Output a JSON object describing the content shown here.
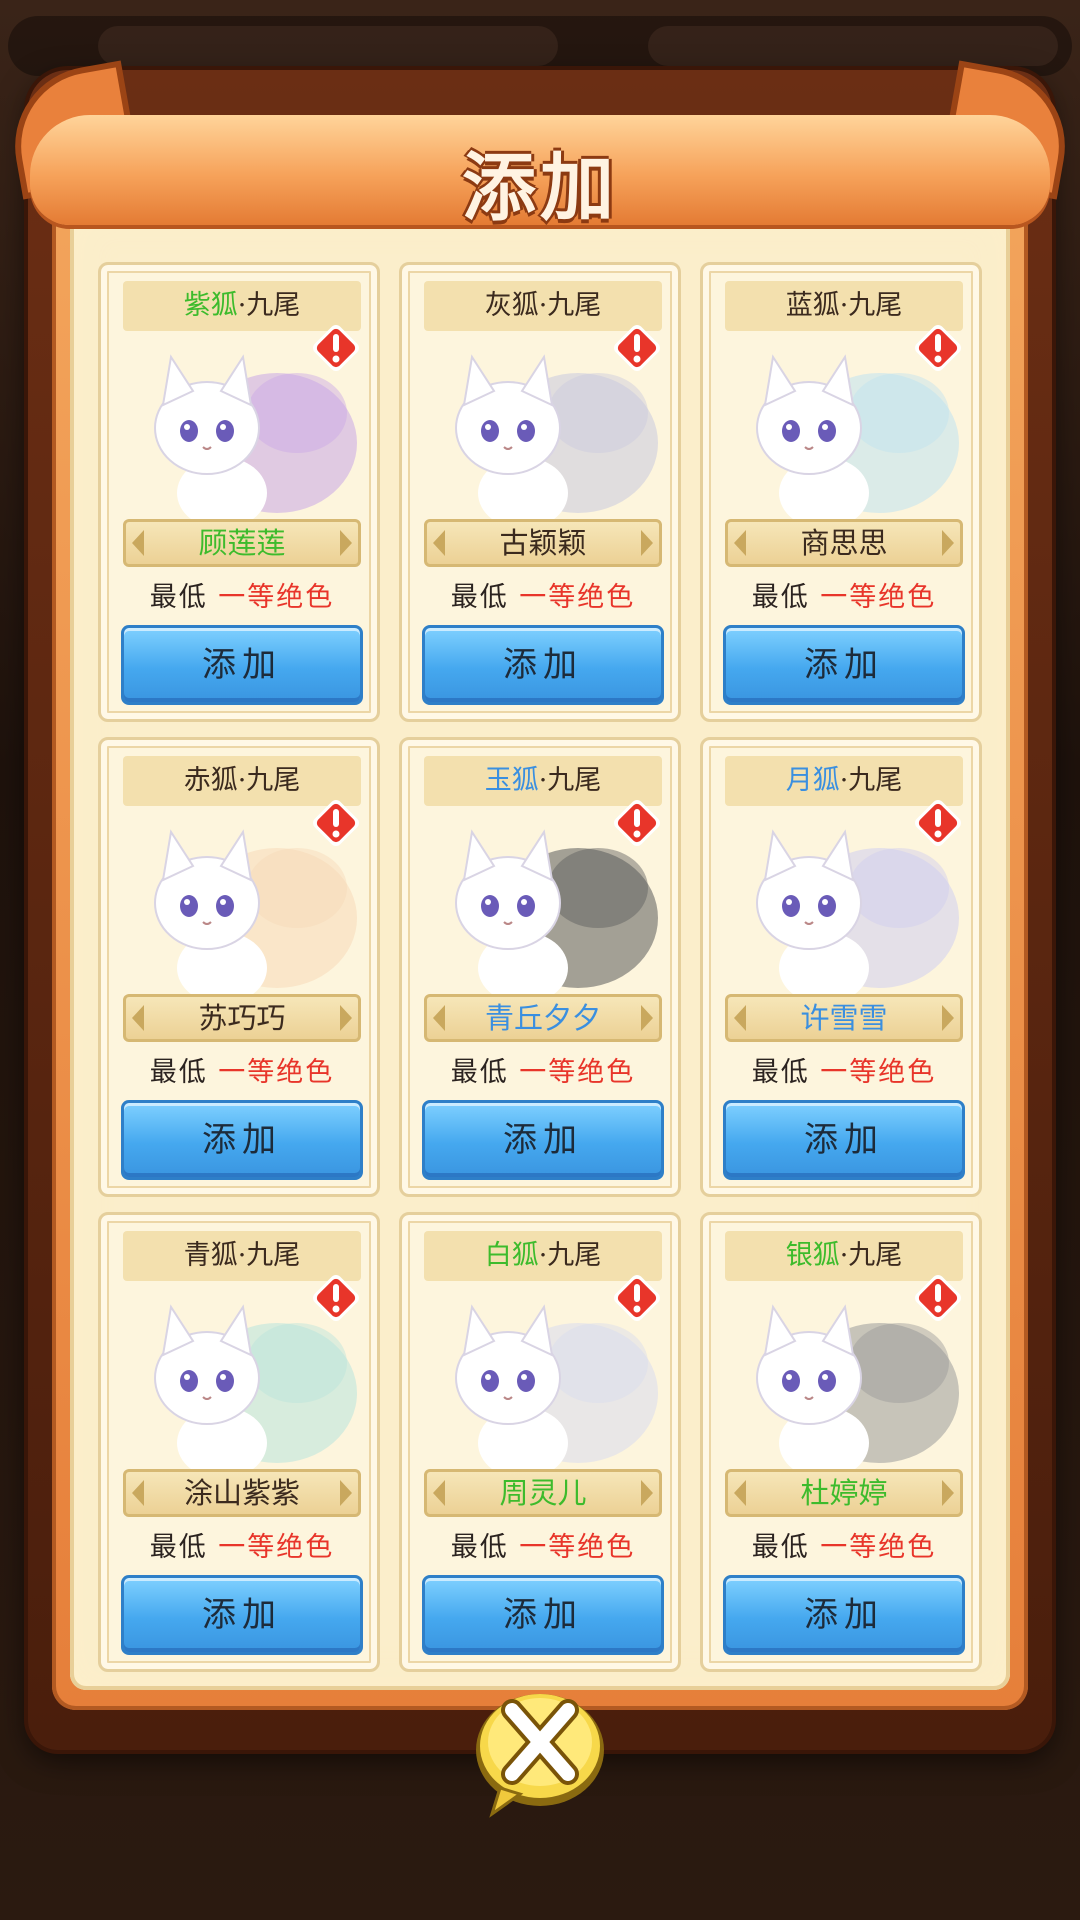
{
  "dialog": {
    "title": "添加",
    "close_icon": "close-x-icon"
  },
  "cards": [
    {
      "color_word": "紫狐",
      "suffix": "·九尾",
      "title_color": "green",
      "name": "顾莲莲",
      "name_color": "green",
      "req_prefix": "最低",
      "req_grade": "一等绝色",
      "button": "添加",
      "fox_tint": "#c9a6e6"
    },
    {
      "color_word": "灰狐",
      "suffix": "·九尾",
      "title_color": "default",
      "name": "古颖颖",
      "name_color": "default",
      "req_prefix": "最低",
      "req_grade": "一等绝色",
      "button": "添加",
      "fox_tint": "#c9c9de"
    },
    {
      "color_word": "蓝狐",
      "suffix": "·九尾",
      "title_color": "default",
      "name": "商思思",
      "name_color": "default",
      "req_prefix": "最低",
      "req_grade": "一等绝色",
      "button": "添加",
      "fox_tint": "#bfe2f0"
    },
    {
      "color_word": "赤狐",
      "suffix": "·九尾",
      "title_color": "default",
      "name": "苏巧巧",
      "name_color": "default",
      "req_prefix": "最低",
      "req_grade": "一等绝色",
      "button": "添加",
      "fox_tint": "#f7d9b8"
    },
    {
      "color_word": "玉狐",
      "suffix": "·九尾",
      "title_color": "blue",
      "name": "青丘夕夕",
      "name_color": "blue",
      "req_prefix": "最低",
      "req_grade": "一等绝色",
      "button": "添加",
      "fox_tint": "#5a5a5a"
    },
    {
      "color_word": "月狐",
      "suffix": "·九尾",
      "title_color": "blue",
      "name": "许雪雪",
      "name_color": "blue",
      "req_prefix": "最低",
      "req_grade": "一等绝色",
      "button": "添加",
      "fox_tint": "#cfcdf0"
    },
    {
      "color_word": "青狐",
      "suffix": "·九尾",
      "title_color": "default",
      "name": "涂山紫紫",
      "name_color": "default",
      "req_prefix": "最低",
      "req_grade": "一等绝色",
      "button": "添加",
      "fox_tint": "#b8e4dc"
    },
    {
      "color_word": "白狐",
      "suffix": "·九尾",
      "title_color": "green",
      "name": "周灵儿",
      "name_color": "green",
      "req_prefix": "最低",
      "req_grade": "一等绝色",
      "button": "添加",
      "fox_tint": "#d8dbee"
    },
    {
      "color_word": "银狐",
      "suffix": "·九尾",
      "title_color": "green",
      "name": "杜婷婷",
      "name_color": "green",
      "req_prefix": "最低",
      "req_grade": "一等绝色",
      "button": "添加",
      "fox_tint": "#9a9a9a"
    }
  ],
  "icons": {
    "alert": "alert-exclamation-icon",
    "fox": "fox-portrait"
  },
  "colors": {
    "grade_red": "#e8352a",
    "green": "#3dbb2c",
    "blue": "#3a8fe0",
    "button_blue": "#45a8ef"
  }
}
